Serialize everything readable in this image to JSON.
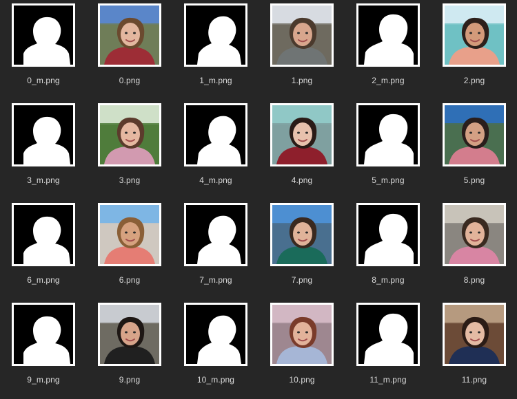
{
  "files": [
    {
      "name": "0_m.png",
      "kind": "mask",
      "icon": "mask-thumbnail"
    },
    {
      "name": "0.png",
      "kind": "photo",
      "icon": "selfie-thumbnail",
      "colors": {
        "sky": "#5a86c9",
        "bg": "#6f7d58",
        "skin": "#e3b79f",
        "hair": "#6b4a2f",
        "shirt": "#9d2d36"
      }
    },
    {
      "name": "1_m.png",
      "kind": "mask",
      "icon": "mask-thumbnail"
    },
    {
      "name": "1.png",
      "kind": "photo",
      "icon": "selfie-thumbnail",
      "colors": {
        "sky": "#d7dbe1",
        "bg": "#6e6a5f",
        "skin": "#d8a68d",
        "hair": "#4b3a2d",
        "shirt": "#6f7474"
      }
    },
    {
      "name": "2_m.png",
      "kind": "mask",
      "icon": "mask-thumbnail"
    },
    {
      "name": "2.png",
      "kind": "photo",
      "icon": "selfie-thumbnail",
      "colors": {
        "sky": "#cfe9f1",
        "bg": "#6fc1c4",
        "skin": "#d39a7a",
        "hair": "#2d201b",
        "shirt": "#e8a08a"
      }
    },
    {
      "name": "3_m.png",
      "kind": "mask",
      "icon": "mask-thumbnail"
    },
    {
      "name": "3.png",
      "kind": "photo",
      "icon": "selfie-thumbnail",
      "colors": {
        "sky": "#cfe0c8",
        "bg": "#4f7c3b",
        "skin": "#e5b8a1",
        "hair": "#5c3b2c",
        "shirt": "#d29ab0"
      }
    },
    {
      "name": "4_m.png",
      "kind": "mask",
      "icon": "mask-thumbnail"
    },
    {
      "name": "4.png",
      "kind": "photo",
      "icon": "selfie-thumbnail",
      "colors": {
        "sky": "#90c8c6",
        "bg": "#7fa0a0",
        "skin": "#e7c1ad",
        "hair": "#2a1b17",
        "shirt": "#8e1f2c"
      }
    },
    {
      "name": "5_m.png",
      "kind": "mask",
      "icon": "mask-thumbnail"
    },
    {
      "name": "5.png",
      "kind": "photo",
      "icon": "selfie-thumbnail",
      "colors": {
        "sky": "#2f6fb6",
        "bg": "#4a6f50",
        "skin": "#d3a084",
        "hair": "#2a1e1c",
        "shirt": "#d37d8d"
      }
    },
    {
      "name": "6_m.png",
      "kind": "mask",
      "icon": "mask-thumbnail"
    },
    {
      "name": "6.png",
      "kind": "photo",
      "icon": "selfie-thumbnail",
      "colors": {
        "sky": "#7eb6e4",
        "bg": "#cfc8c0",
        "skin": "#d6a27f",
        "hair": "#8a5f37",
        "shirt": "#e57d74"
      }
    },
    {
      "name": "7_m.png",
      "kind": "mask",
      "icon": "mask-thumbnail"
    },
    {
      "name": "7.png",
      "kind": "photo",
      "icon": "selfie-thumbnail",
      "colors": {
        "sky": "#4d8fd2",
        "bg": "#496f8f",
        "skin": "#e0b399",
        "hair": "#3a291f",
        "shirt": "#1a6b5a"
      }
    },
    {
      "name": "8_m.png",
      "kind": "mask",
      "icon": "mask-thumbnail"
    },
    {
      "name": "8.png",
      "kind": "photo",
      "icon": "selfie-thumbnail",
      "colors": {
        "sky": "#c8c3b9",
        "bg": "#8a8680",
        "skin": "#e2b39a",
        "hair": "#3a2a20",
        "shirt": "#d885a3"
      }
    },
    {
      "name": "9_m.png",
      "kind": "mask",
      "icon": "mask-thumbnail"
    },
    {
      "name": "9.png",
      "kind": "photo",
      "icon": "selfie-thumbnail",
      "colors": {
        "sky": "#c8cbd0",
        "bg": "#6e6b62",
        "skin": "#d7a48a",
        "hair": "#1e1714",
        "shirt": "#202020"
      }
    },
    {
      "name": "10_m.png",
      "kind": "mask",
      "icon": "mask-thumbnail"
    },
    {
      "name": "10.png",
      "kind": "photo",
      "icon": "selfie-thumbnail",
      "colors": {
        "sky": "#d2b7c3",
        "bg": "#9e8790",
        "skin": "#e2b29a",
        "hair": "#7a3b2a",
        "shirt": "#a6b6d6"
      }
    },
    {
      "name": "11_m.png",
      "kind": "mask",
      "icon": "mask-thumbnail"
    },
    {
      "name": "11.png",
      "kind": "photo",
      "icon": "selfie-thumbnail",
      "colors": {
        "sky": "#b69a7f",
        "bg": "#6c4b37",
        "skin": "#e4bba4",
        "hair": "#2b1c16",
        "shirt": "#1f2f55"
      }
    }
  ]
}
